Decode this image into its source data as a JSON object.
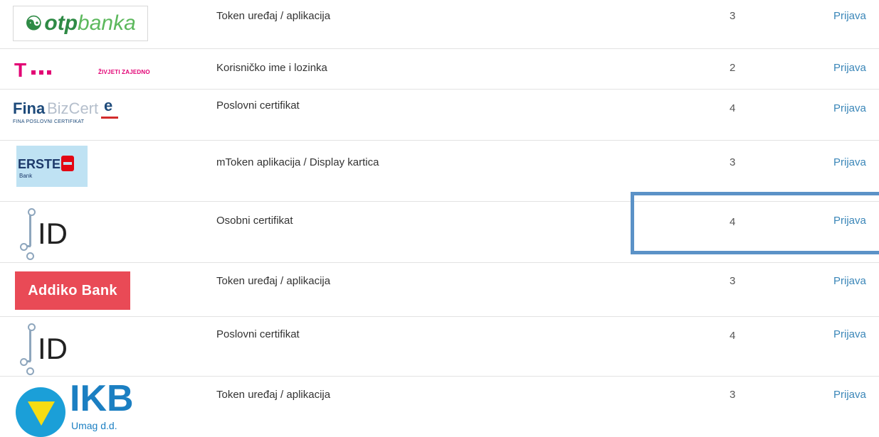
{
  "rows": [
    {
      "logo": "otpbanka",
      "logo_parts": [
        "otp",
        "banka"
      ],
      "method": "Token uređaj / aplikacija",
      "level": "3",
      "action": "Prijava"
    },
    {
      "logo": "T Telekom",
      "logo_parts": [
        "T",
        "ŽIVJETI ZAJEDNO"
      ],
      "method": "Korisničko ime i lozinka",
      "level": "2",
      "action": "Prijava"
    },
    {
      "logo": "FinaBizCert",
      "logo_parts": [
        "Fina",
        "BizCert",
        "FINA POSLOVNI CERTIFIKAT"
      ],
      "method": "Poslovni certifikat",
      "level": "4",
      "action": "Prijava"
    },
    {
      "logo": "ERSTE Bank",
      "logo_parts": [
        "ERSTE",
        "Bank"
      ],
      "method": "mToken aplikacija / Display kartica",
      "level": "3",
      "action": "Prijava"
    },
    {
      "logo": "eID",
      "logo_parts": [
        "ID"
      ],
      "method": "Osobni certifikat",
      "level": "4",
      "action": "Prijava"
    },
    {
      "logo": "Addiko Bank",
      "logo_parts": [
        "Addiko Bank"
      ],
      "method": "Token uređaj / aplikacija",
      "level": "3",
      "action": "Prijava"
    },
    {
      "logo": "eID",
      "logo_parts": [
        "ID"
      ],
      "method": "Poslovni certifikat",
      "level": "4",
      "action": "Prijava"
    },
    {
      "logo": "IKB Umag d.d.",
      "logo_parts": [
        "IKB",
        "Umag d.d."
      ],
      "method": "Token uređaj / aplikacija",
      "level": "3",
      "action": "Prijava"
    }
  ],
  "icons": {
    "otp": "otp-bank-swirl-icon",
    "eid": "eid-circuit-icon",
    "erste": "erste-s-icon",
    "ikb": "ikb-triangle-icon"
  },
  "colors": {
    "link": "#3a86b8",
    "highlight": "#5b92c7",
    "divider": "#e3e3e3"
  }
}
